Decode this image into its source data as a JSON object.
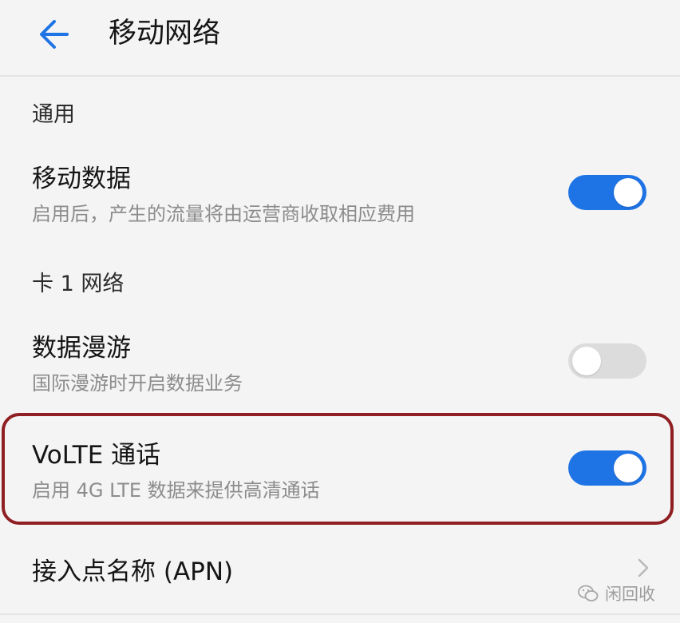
{
  "header": {
    "title": "移动网络",
    "back_icon": "back-arrow-icon"
  },
  "sections": {
    "general": "通用",
    "sim1": "卡 1 网络"
  },
  "rows": {
    "mobile_data": {
      "title": "移动数据",
      "subtitle": "启用后，产生的流量将由运营商收取相应费用",
      "enabled": true
    },
    "data_roaming": {
      "title": "数据漫游",
      "subtitle": "国际漫游时开启数据业务",
      "enabled": false
    },
    "volte": {
      "title": "VoLTE 通话",
      "subtitle": "启用 4G LTE 数据来提供高清通话",
      "enabled": true
    },
    "apn": {
      "title": "接入点名称 (APN)",
      "icon": "chevron-right-icon"
    }
  },
  "colors": {
    "accent": "#1f74e5",
    "toggle_off": "#dcdcdc",
    "highlight": "#8f1f23",
    "background": "#f4f4f4"
  },
  "watermark": {
    "text": "闲回收",
    "icon": "wechat-icon"
  }
}
